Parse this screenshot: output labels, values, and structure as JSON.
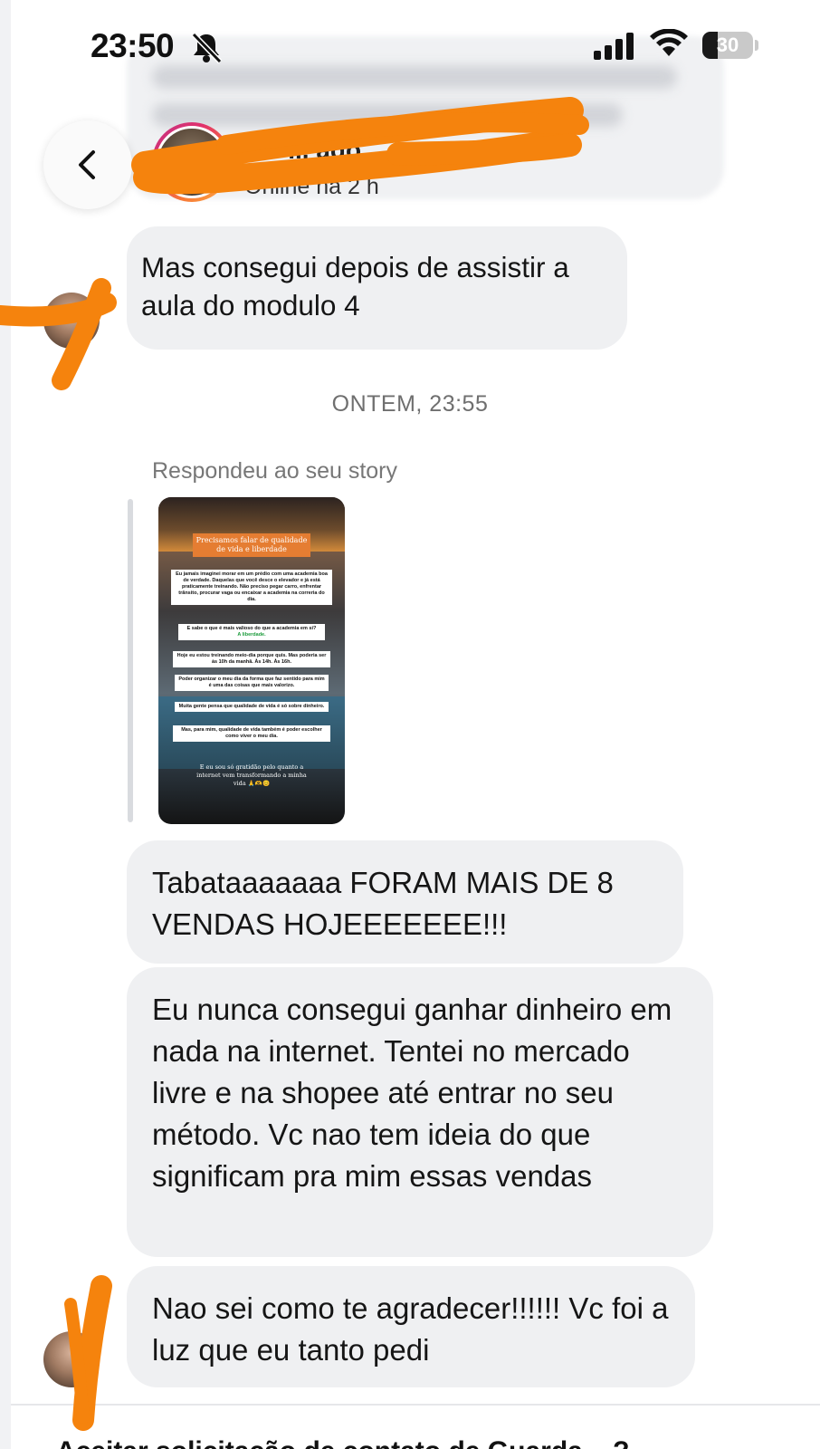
{
  "status_bar": {
    "time": "23:50",
    "battery": "30",
    "battery_level": 0.3
  },
  "header": {
    "contact_name": "...o ... ago",
    "online_status": "Online há 2 h"
  },
  "messages": [
    {
      "text": "Mas consegui depois de assistir a aula do modulo 4"
    },
    {
      "text": "Tabataaaaaaa FORAM MAIS DE 8 VENDAS HOJEEEEEEE!!!"
    },
    {
      "text": "Eu nunca consegui ganhar dinheiro em nada na internet. Tentei no mercado livre e na shopee até entrar no seu método. Vc nao tem ideia do que significam pra mim essas vendas"
    },
    {
      "text": "Nao sei como te agradecer!!!!!! Vc foi a luz que eu tanto pedi"
    }
  ],
  "timestamp": "ONTEM, 23:55",
  "story_reply": {
    "label": "Respondeu ao seu story",
    "story": {
      "title": "Precisamos falar de qualidade de vida e liberdade",
      "p1": "Eu jamais imaginei morar em um prédio com uma academia boa de verdade. Daquelas que você desce o elevador e já está praticamente treinando. Não preciso pegar carro, enfrentar trânsito, procurar vaga ou encaixar a academia na correria do dia.",
      "p2": "E sabe o que é mais valioso do que a academia em si?",
      "p2_highlight": "A liberdade.",
      "p3": "Hoje eu estou treinando meio-dia porque quis. Mas poderia ser às 10h da manhã. Às 14h. Às 16h.",
      "p4": "Poder organizar o meu dia da forma que faz sentido para mim é uma das coisas que mais valorizo.",
      "p5": "Muita gente pensa que qualidade de vida é só sobre dinheiro.",
      "p6": "Mas, para mim, qualidade de vida também é poder escolher como viver o meu dia.",
      "footer": "E eu sou só gratidão pelo quanto a internet vem transformando a minha vida 🙏🫶😊"
    }
  },
  "bottom_banner": "Aceitar solicitação de contato de Guarda... ?",
  "colors": {
    "bubble": "#eff0f2",
    "scribble": "#f5830d",
    "story_accent": "#e57d32"
  }
}
